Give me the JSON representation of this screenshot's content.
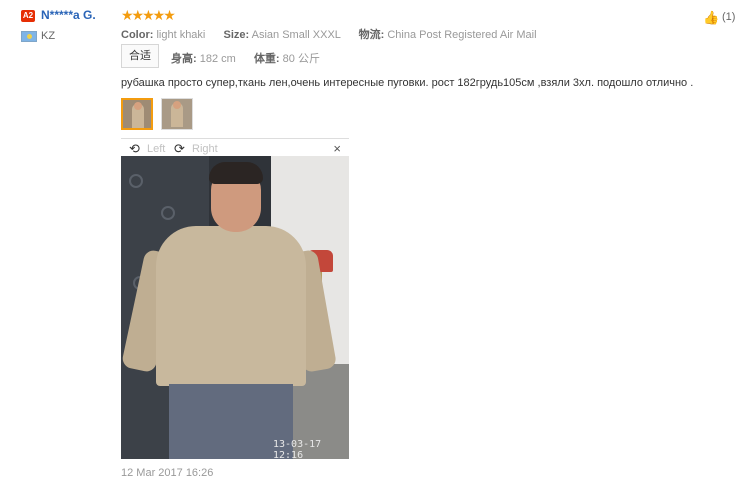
{
  "reviewer": {
    "level_badge": "A2",
    "name": "N*****a G.",
    "country": "KZ"
  },
  "review": {
    "rating_stars": 5,
    "stars_text": "★★★★★",
    "color_label": "Color:",
    "color_value": "light khaki",
    "size_label": "Size:",
    "size_value": "Asian Small XXXL",
    "shipping_label": "物流:",
    "shipping_value": "China Post Registered Air Mail",
    "fit_badge": "合适",
    "height_label": "身高:",
    "height_value": "182 cm",
    "weight_label": "体重:",
    "weight_value": "80 公斤",
    "text": "рубашка просто супер,ткань лен,очень интересные пуговки. рост 182грудь105см ,взяли 3хл. подошло отлично .",
    "date": "12 Mar 2017 16:26",
    "helpful_count": "(1)"
  },
  "viewer": {
    "rotate_left": "Left",
    "rotate_right": "Right",
    "close": "×",
    "photo_timestamp": "13-03-17 12:16"
  },
  "colors": {
    "star": "#f39c0f",
    "username": "#2a64b7",
    "badge": "#e62e04"
  }
}
